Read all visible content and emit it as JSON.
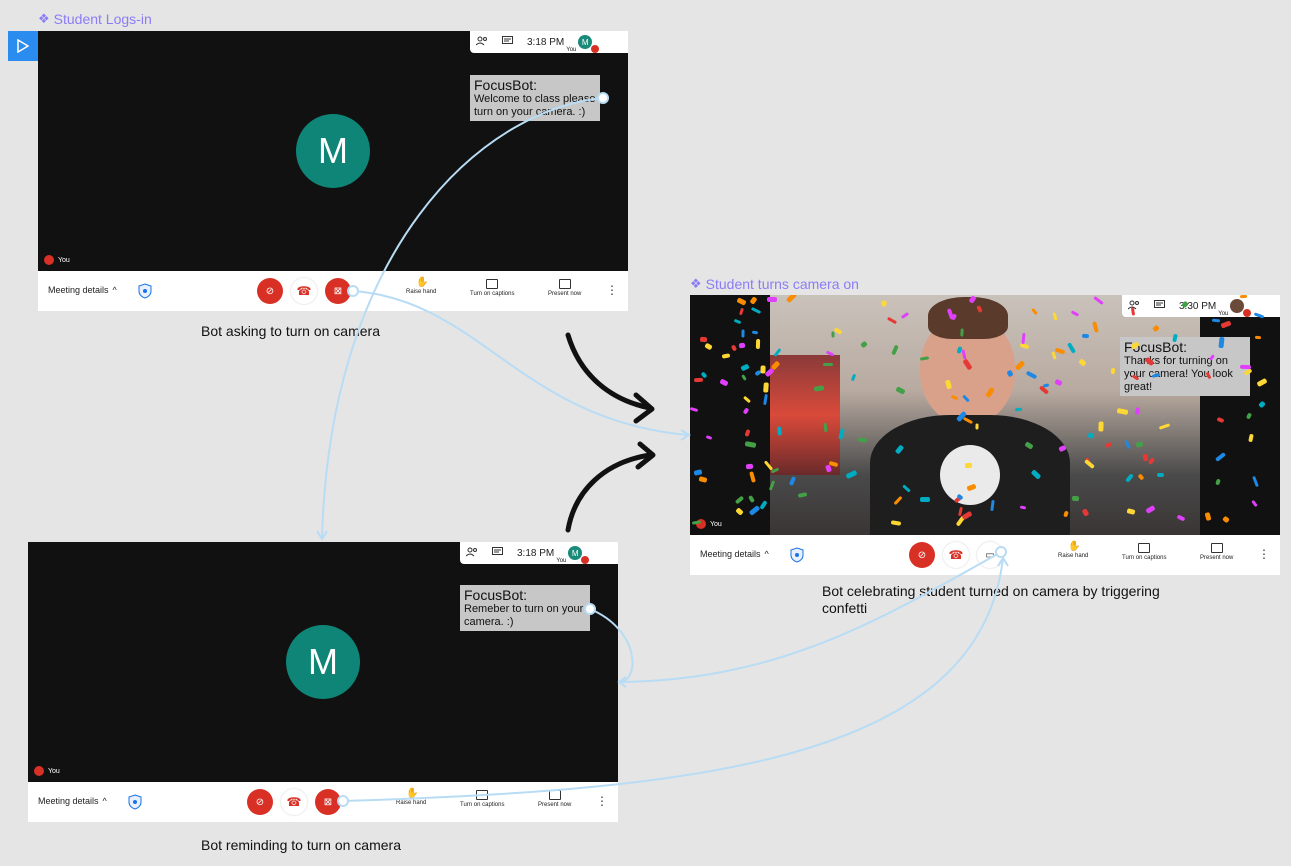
{
  "frames": {
    "login": {
      "label": "Student Logs-in",
      "caption": "Bot asking to turn on camera"
    },
    "reminder": {
      "caption": "Bot reminding to turn on camera"
    },
    "camera_on": {
      "label": "Student turns camera on",
      "caption": "Bot celebrating student turned on camera by triggering confetti"
    }
  },
  "meet": {
    "time_a": "3:18 PM",
    "time_b": "3:18 PM",
    "time_c": "3:30 PM",
    "you": "You",
    "avatar_initial": "M",
    "meeting_details": "Meeting details",
    "raise_hand": "Raise hand",
    "captions": "Turn on captions",
    "present": "Present now"
  },
  "bot": {
    "name": "FocusBot:",
    "msg_welcome": "Welcome to class please turn on your camera. :)",
    "msg_remind": "Remeber to turn on your camera. :)",
    "msg_thanks": "Thanks for turning on your camera! You look great!"
  },
  "colors": {
    "accent": "#8b7cf6",
    "meet_red": "#d93025",
    "avatar": "#0f8577",
    "connector": "#b9dcf5",
    "arrow": "#111111"
  },
  "icons": [
    "play-icon",
    "people-icon",
    "chat-icon",
    "mic-off-icon",
    "hangup-icon",
    "camera-off-icon",
    "hand-icon",
    "captions-icon",
    "present-icon",
    "more-icon",
    "shield-icon",
    "chevron-up-icon",
    "component-icon"
  ]
}
